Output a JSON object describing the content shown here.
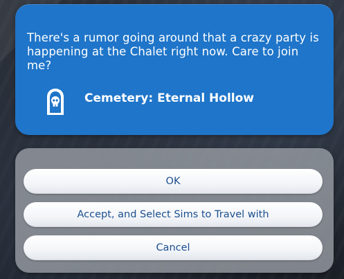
{
  "dialog": {
    "message": "There's a rumor going around that a crazy party is happening at the Chalet right now. Care to join me?",
    "venue_icon": "gravestone-skull-icon",
    "venue_label": "Cemetery: Eternal Hollow"
  },
  "buttons": {
    "ok": "OK",
    "accept": "Accept, and Select Sims to Travel with",
    "cancel": "Cancel"
  },
  "colors": {
    "bubble": "#1f75c9",
    "button_text": "#1b4f8f",
    "panel": "#969ba2"
  }
}
